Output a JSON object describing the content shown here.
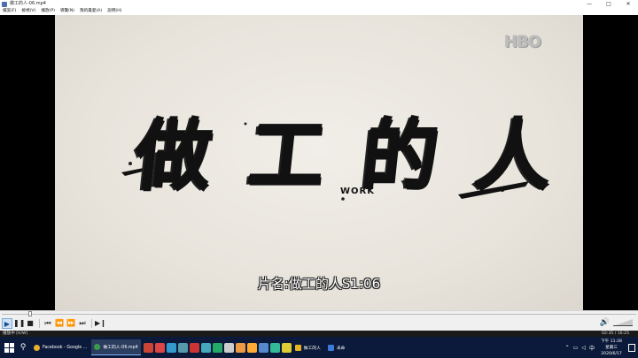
{
  "window": {
    "title": "做工的人-06.mp4",
    "controls": {
      "minimize": "—",
      "maximize": "□",
      "close": "✕"
    }
  },
  "menu": [
    "檔案(F)",
    "檢視(V)",
    "播放(P)",
    "導覽(N)",
    "我的最愛(A)",
    "說明(H)"
  ],
  "video": {
    "watermark": "HBO",
    "title_chars": [
      "做",
      "工",
      "的",
      "人"
    ],
    "title_en": "WORK",
    "subtitle": "片名:做工的人S1:06",
    "progress": 0.0,
    "frame_colors": {
      "background": "#e8e4dc",
      "ink": "#111111"
    }
  },
  "player_controls": {
    "play": "▶",
    "pause": "❚❚",
    "stop": "■",
    "prev": "⏮",
    "rewind": "⏪",
    "forward": "⏩",
    "next": "⏭",
    "step": "▶❙",
    "volume_icon": "🔊",
    "volume_level": 1.0
  },
  "status": {
    "left": "播放中 [H/W]",
    "time": "02:35 / 16:25"
  },
  "taskbar": {
    "search_icon": "⚲",
    "tasks": [
      {
        "label": "Facebook - Google ...",
        "color": "#e8b030",
        "active": false
      },
      {
        "label": "做工的人-06.mp4",
        "color": "#3a9a4a",
        "active": true
      }
    ],
    "pinned_colors": [
      "#c43",
      "#d44",
      "#39c",
      "#59a",
      "#c33",
      "#4ab",
      "#2a6",
      "#ccc",
      "#e94",
      "#fa3",
      "#58c",
      "#3b9",
      "#dc3"
    ],
    "open_windows": [
      {
        "label": "做工的人",
        "color": "#e6b422"
      },
      {
        "label": "未命",
        "color": "#3a7bd5"
      }
    ],
    "tray": {
      "lang": "中",
      "time": "下午 11:28",
      "weekday": "星期三",
      "date": "2020/6/17"
    }
  }
}
